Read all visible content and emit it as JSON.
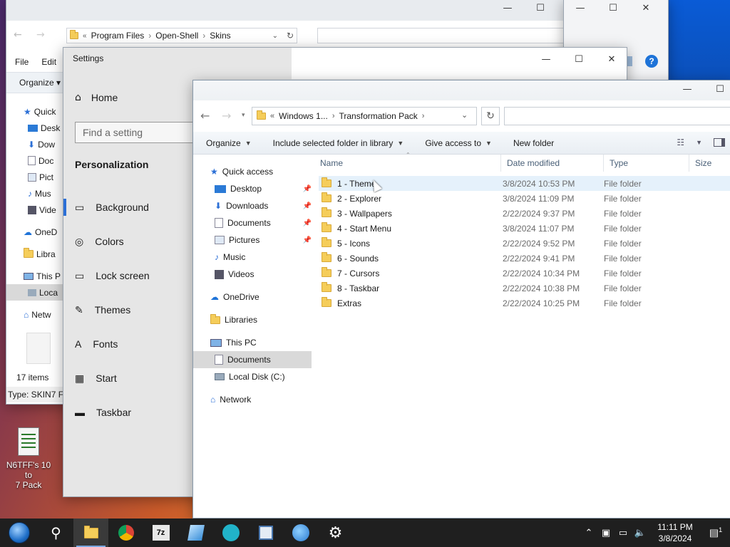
{
  "back_explorer": {
    "breadcrumb": [
      "Program Files",
      "Open-Shell",
      "Skins"
    ],
    "menu": [
      "File",
      "Edit"
    ],
    "organize": "Organize",
    "sidebar": [
      "Quick",
      "Desk",
      "Dow",
      "Doc",
      "Pict",
      "Mus",
      "Vide",
      "OneD",
      "Libra",
      "This P",
      "Loca",
      "Netw"
    ],
    "status": "17 items",
    "type_text": "Type: SKIN7 Fi"
  },
  "settings": {
    "title": "Settings",
    "home": "Home",
    "search_placeholder": "Find a setting",
    "section": "Personalization",
    "nav": [
      "Background",
      "Colors",
      "Lock screen",
      "Themes",
      "Fonts",
      "Start",
      "Taskbar"
    ]
  },
  "explorer": {
    "breadcrumb": [
      "Windows 1...",
      "Transformation Pack"
    ],
    "commands": [
      "Organize",
      "Include selected folder in library",
      "Give access to",
      "New folder"
    ],
    "nav": {
      "quick_access": "Quick access",
      "pinned": [
        "Desktop",
        "Downloads",
        "Documents",
        "Pictures"
      ],
      "unpinned": [
        "Music",
        "Videos"
      ],
      "onedrive": "OneDrive",
      "libraries": "Libraries",
      "this_pc": "This PC",
      "pc_items": [
        "Documents",
        "Local Disk (C:)"
      ],
      "network": "Network"
    },
    "columns": [
      "Name",
      "Date modified",
      "Type",
      "Size"
    ],
    "files": [
      {
        "name": "1 - Theme",
        "date": "3/8/2024 10:53 PM",
        "type": "File folder"
      },
      {
        "name": "2 - Explorer",
        "date": "3/8/2024 11:09 PM",
        "type": "File folder"
      },
      {
        "name": "3 - Wallpapers",
        "date": "2/22/2024 9:37 PM",
        "type": "File folder"
      },
      {
        "name": "4 - Start Menu",
        "date": "3/8/2024 11:07 PM",
        "type": "File folder"
      },
      {
        "name": "5 - Icons",
        "date": "2/22/2024 9:52 PM",
        "type": "File folder"
      },
      {
        "name": "6 - Sounds",
        "date": "2/22/2024 9:41 PM",
        "type": "File folder"
      },
      {
        "name": "7 - Cursors",
        "date": "2/22/2024 10:34 PM",
        "type": "File folder"
      },
      {
        "name": "8 - Taskbar",
        "date": "2/22/2024 10:38 PM",
        "type": "File folder"
      },
      {
        "name": "Extras",
        "date": "2/22/2024 10:25 PM",
        "type": "File folder"
      }
    ]
  },
  "desktop_icon": {
    "line1": "N6TFF's 10 to",
    "line2": "7 Pack"
  },
  "taskbar": {
    "apps": [
      "start-orb",
      "search",
      "file-explorer",
      "chrome",
      "7zip",
      "app-blue",
      "app-teal",
      "app-window",
      "app-globe",
      "settings"
    ],
    "time": "11:11 PM",
    "date": "3/8/2024",
    "notification_count": "1"
  }
}
